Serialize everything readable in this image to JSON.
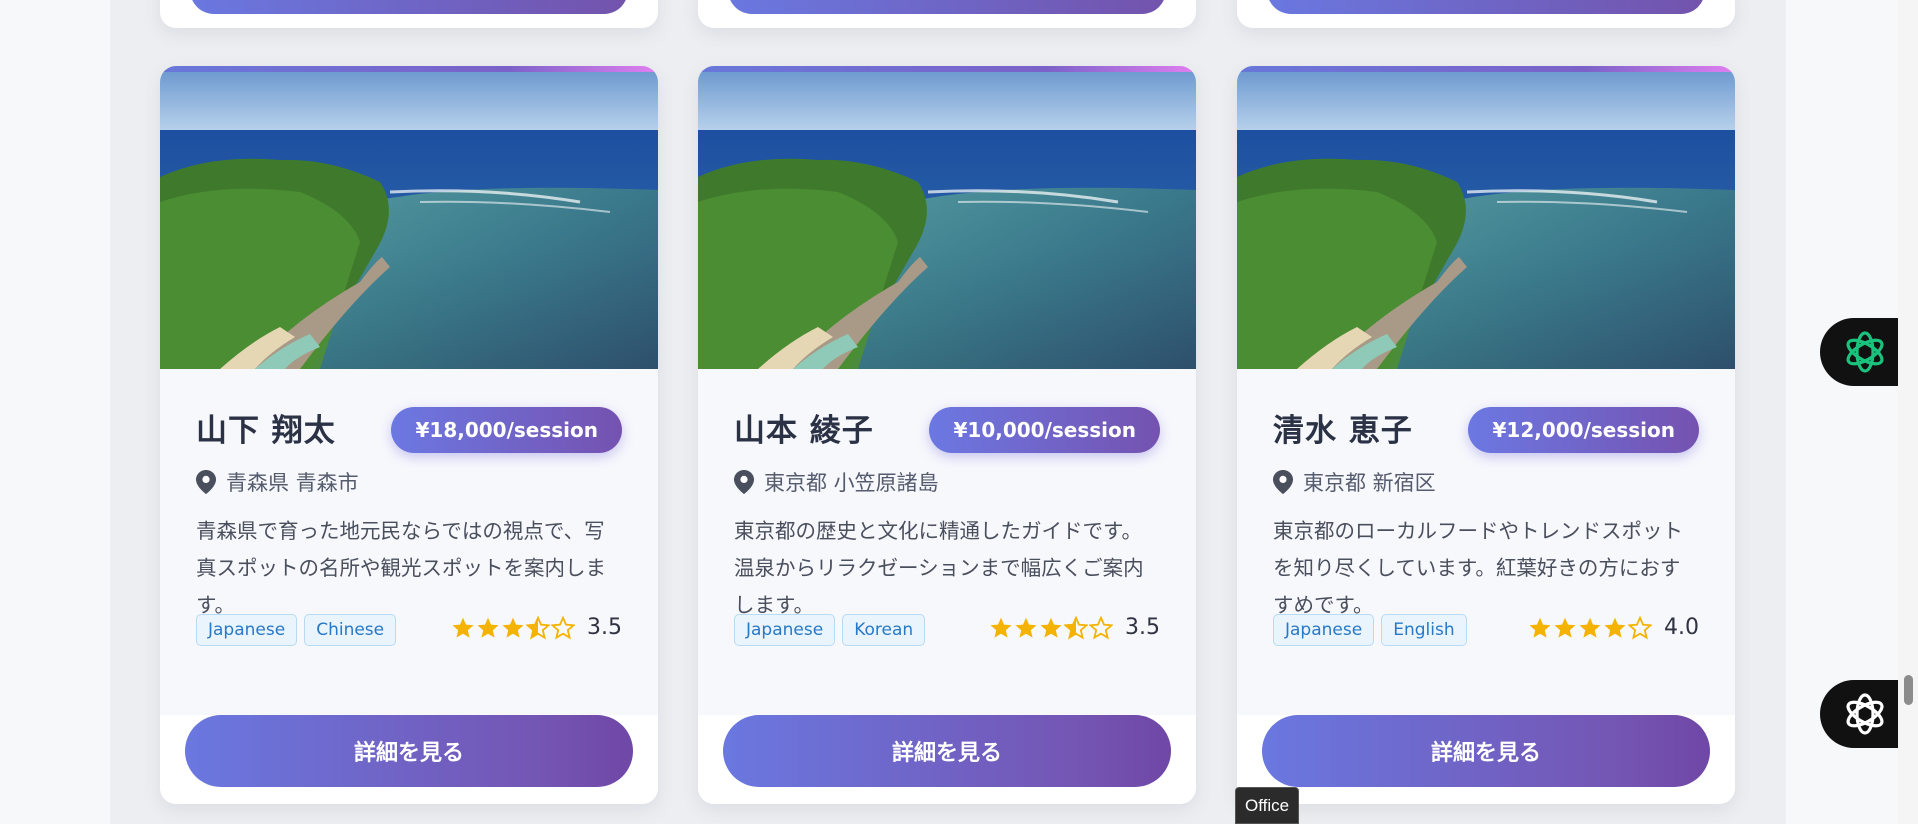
{
  "cards": [
    {
      "name": "山下 翔太",
      "price": "¥18,000/session",
      "location": "青森県 青森市",
      "description": "青森県で育った地元民ならではの視点で、写真スポットの名所や観光スポットを案内します。",
      "languages": [
        "Japanese",
        "Chinese"
      ],
      "rating": 3.5,
      "rating_label": "3.5",
      "button": "詳細を見る"
    },
    {
      "name": "山本 綾子",
      "price": "¥10,000/session",
      "location": "東京都 小笠原諸島",
      "description": "東京都の歴史と文化に精通したガイドです。温泉からリラクゼーションまで幅広くご案内します。",
      "languages": [
        "Japanese",
        "Korean"
      ],
      "rating": 3.5,
      "rating_label": "3.5",
      "button": "詳細を見る"
    },
    {
      "name": "清水 恵子",
      "price": "¥12,000/session",
      "location": "東京都 新宿区",
      "description": "東京都のローカルフードやトレンドスポットを知り尽くしています。紅葉好きの方におすすめです。",
      "languages": [
        "Japanese",
        "English"
      ],
      "rating": 4.0,
      "rating_label": "4.0",
      "button": "詳細を見る"
    }
  ],
  "icons": {
    "location": "map-pin-icon",
    "star": "star-icon",
    "assistant": "openai-logo-icon"
  },
  "colors": {
    "accent_start": "#6a78e0",
    "accent_end": "#7353ac",
    "star": "#f5b301",
    "tag_text": "#2779c7"
  },
  "tooltip": "Office"
}
